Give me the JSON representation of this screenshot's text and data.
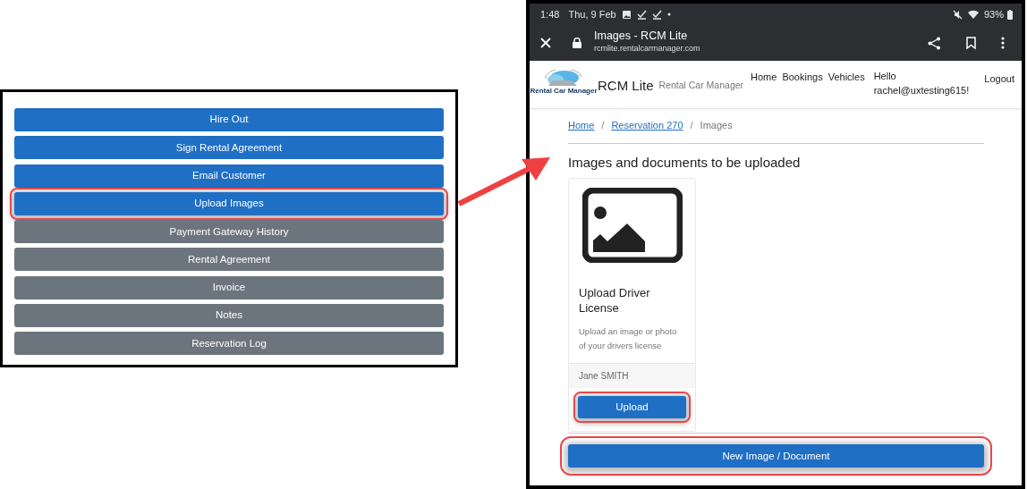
{
  "left_panel": {
    "buttons": [
      {
        "label": "Hire Out",
        "kind": "primary",
        "highlighted": false
      },
      {
        "label": "Sign Rental Agreement",
        "kind": "primary",
        "highlighted": false
      },
      {
        "label": "Email Customer",
        "kind": "primary",
        "highlighted": false
      },
      {
        "label": "Upload Images",
        "kind": "primary",
        "highlighted": true
      },
      {
        "label": "Payment Gateway History",
        "kind": "secondary",
        "highlighted": false
      },
      {
        "label": "Rental Agreement",
        "kind": "secondary",
        "highlighted": false
      },
      {
        "label": "Invoice",
        "kind": "secondary",
        "highlighted": false
      },
      {
        "label": "Notes",
        "kind": "secondary",
        "highlighted": false
      },
      {
        "label": "Reservation Log",
        "kind": "secondary",
        "highlighted": false
      }
    ]
  },
  "phone": {
    "status_bar": {
      "time": "1:48",
      "date": "Thu, 9 Feb",
      "battery": "93%"
    },
    "browser": {
      "title": "Images - RCM Lite",
      "url": "rcmlite.rentalcarmanager.com"
    },
    "navbar": {
      "logo_text": "Rental Car Manager",
      "brand": "RCM Lite",
      "tagline": "Rental Car Manager",
      "links": [
        "Home",
        "Bookings",
        "Vehicles"
      ],
      "greeting": "Hello rachel@uxtesting615!",
      "logout": "Logout"
    },
    "breadcrumb": {
      "separator": "/",
      "items": [
        {
          "label": "Home",
          "link": true
        },
        {
          "label": "Reservation 270",
          "link": true
        },
        {
          "label": "Images",
          "link": false
        }
      ]
    },
    "heading": "Images and documents to be uploaded",
    "cards": [
      {
        "title": "Upload Driver License",
        "description": "Upload an image or photo of your drivers license",
        "footer": "Jane SMITH",
        "button": {
          "label": "Upload",
          "highlighted": true
        }
      }
    ],
    "new_button": {
      "label": "New Image / Document",
      "highlighted": true
    }
  }
}
